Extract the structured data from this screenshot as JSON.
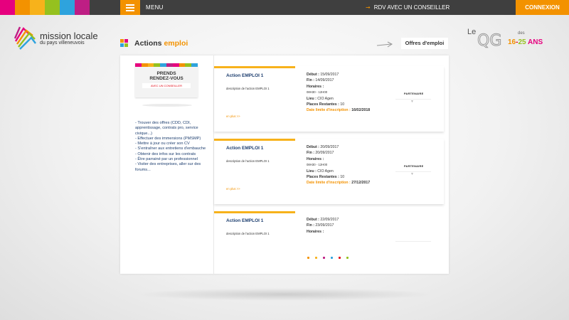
{
  "header": {
    "menu_label": "MENU",
    "rdv_label": "RDV AVEC UN CONSEILLER",
    "connexion_label": "CONNEXION",
    "strip_colors": [
      "#e6007e",
      "#f39200",
      "#f7b21b",
      "#95c11f",
      "#2ea3dd",
      "#be1e84"
    ]
  },
  "logo": {
    "title": "mission locale",
    "subtitle": "du pays villeneuvois"
  },
  "section": {
    "title_part1": "Actions",
    "title_part2": "emploi",
    "offres_button": "Offres d'emploi"
  },
  "qg_logo": {
    "le": "Le",
    "des": "des",
    "age_part1": "16",
    "age_part2": "-",
    "age_part3": "25",
    "age_part4": "ANS"
  },
  "sidebar": {
    "card_line1": "PRENDS",
    "card_line2": "RENDEZ-VOUS",
    "card_line3": "AVEC UN CONSEILLER",
    "items": [
      "- Trouver des offres (CDD, CDI, apprentissage, contrats pro, service civique...)",
      "- Effectuer des immersions (PMSMP)",
      "- Mettre à jour ou créer son CV",
      "- S'entraîner aux entretiens d'embauche",
      "- Obtenir des infos sur les contrats",
      "- Être parrainé par un professionnel",
      "- Visiter des entreprises, aller sur des forums..."
    ]
  },
  "offers": [
    {
      "name": "Action EMPLOI 1",
      "desc": "description de l'action EMPLOI 1",
      "more": "en plus >>",
      "debut_label": "Début :",
      "debut": "15/09/2017",
      "fin_label": "Fin :",
      "fin": "14/09/2017",
      "horaires_label": "Horaires :",
      "horaires": "08H30 - 12H00",
      "lieu_label": "Lieu :",
      "lieu": "CIO Agen",
      "places_label": "Places Restantes :",
      "places": "10",
      "limite_label": "Date limite d'inscription :",
      "limite": "16/02/2018",
      "partner": "PARTENAIRE"
    },
    {
      "name": "Action EMPLOI 1",
      "desc": "description de l'action EMPLOI 1",
      "more": "en plus >>",
      "debut_label": "Début :",
      "debut": "20/09/2017",
      "fin_label": "Fin :",
      "fin": "20/09/2017",
      "horaires_label": "Horaires :",
      "horaires": "08H30 - 12H00",
      "lieu_label": "Lieu :",
      "lieu": "CIO Agen",
      "places_label": "Places Restantes :",
      "places": "10",
      "limite_label": "Date limite d'inscription :",
      "limite": "27/12/2017",
      "partner": "PARTENAIRE"
    },
    {
      "name": "Action EMPLOI 1",
      "desc": "description de l'action EMPLOI 1",
      "debut_label": "Début :",
      "debut": "22/09/2017",
      "fin_label": "Fin :",
      "fin": "23/09/2017",
      "horaires_label": "Horaires :"
    }
  ],
  "pagination_colors": [
    "#f39200",
    "#f7b21b",
    "#be1e84",
    "#2ea3dd",
    "#e30613",
    "#95c11f"
  ],
  "colors": {
    "accent": "#f39200",
    "navy": "#1d3e6f",
    "topbar": "#3f3f3f"
  }
}
